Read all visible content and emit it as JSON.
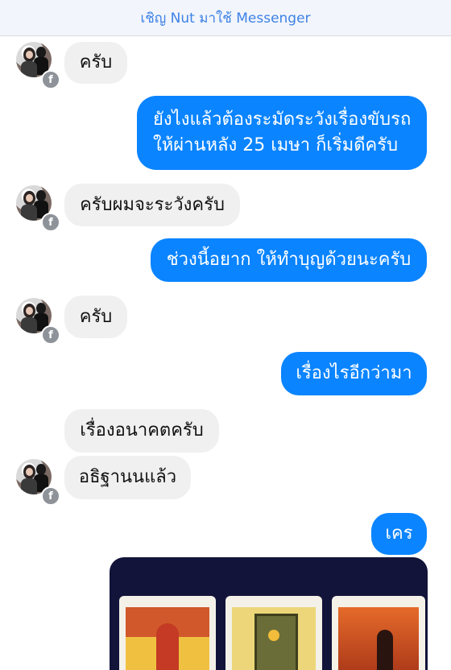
{
  "banner": {
    "text": "เชิญ Nut มาใช้ Messenger"
  },
  "messages": [
    {
      "side": "in",
      "text": "ครับ"
    },
    {
      "side": "out",
      "lines": [
        "ยังไงแล้วต้องระมัดระวังเรื่องขับรถ",
        "ให้ผ่านหลัง 25 เมษา ก็เริ่มดีครับ"
      ]
    },
    {
      "side": "in",
      "text": "ครับผมจะระวังครับ"
    },
    {
      "side": "out",
      "text": "ช่วงนี้อยาก ให้ทำบุญด้วยนะครับ"
    },
    {
      "side": "in",
      "text": "ครับ"
    },
    {
      "side": "out",
      "text": "เรื่องไรอีกว่ามา"
    },
    {
      "side": "in",
      "text": "เรื่องอนาคตครับ"
    },
    {
      "side": "in",
      "text": "อธิฐานนแล้ว"
    },
    {
      "side": "out",
      "text": "เคร"
    }
  ],
  "badge": {
    "glyph": "f"
  },
  "colors": {
    "outgoing": "#0a84ff",
    "incoming": "#f0f0f0",
    "banner_text": "#3d82e6"
  }
}
